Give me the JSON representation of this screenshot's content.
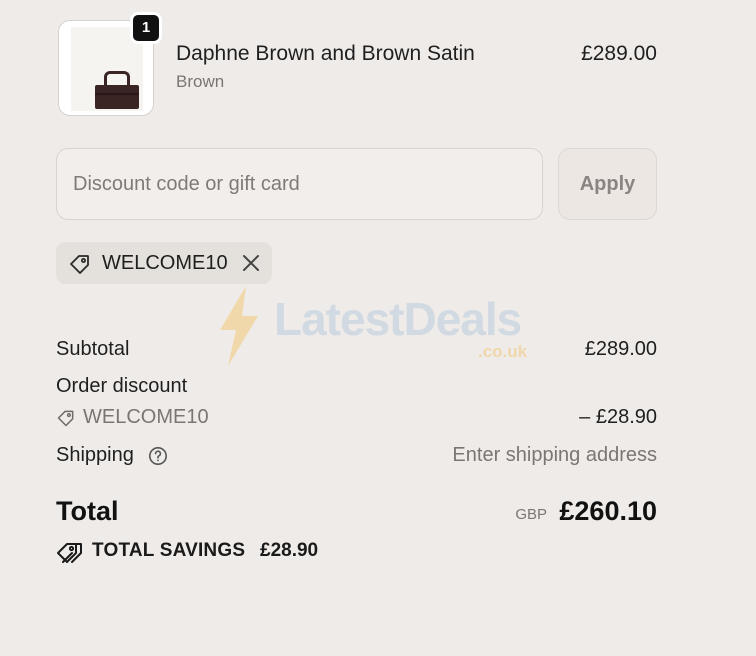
{
  "product": {
    "quantity": "1",
    "name": "Daphne Brown and Brown Satin",
    "variant": "Brown",
    "price": "£289.00",
    "image_icon": "handbag-image"
  },
  "discount": {
    "placeholder": "Discount code or gift card",
    "value": "",
    "apply_label": "Apply",
    "applied_code": "WELCOME10"
  },
  "watermark": {
    "text": "LatestDeals",
    "sub": ".co.uk"
  },
  "summary": {
    "subtotal_label": "Subtotal",
    "subtotal_value": "£289.00",
    "order_discount_label": "Order discount",
    "order_discount_code": "WELCOME10",
    "order_discount_value": "– £28.90",
    "shipping_label": "Shipping",
    "shipping_value": "Enter shipping address",
    "total_label": "Total",
    "total_currency": "GBP",
    "total_value": "£260.10",
    "savings_label": "TOTAL SAVINGS",
    "savings_value": "£28.90"
  },
  "colors": {
    "background": "#efebe8",
    "text": "#1f1f1f",
    "muted": "#7a7674",
    "badge": "#111111"
  }
}
